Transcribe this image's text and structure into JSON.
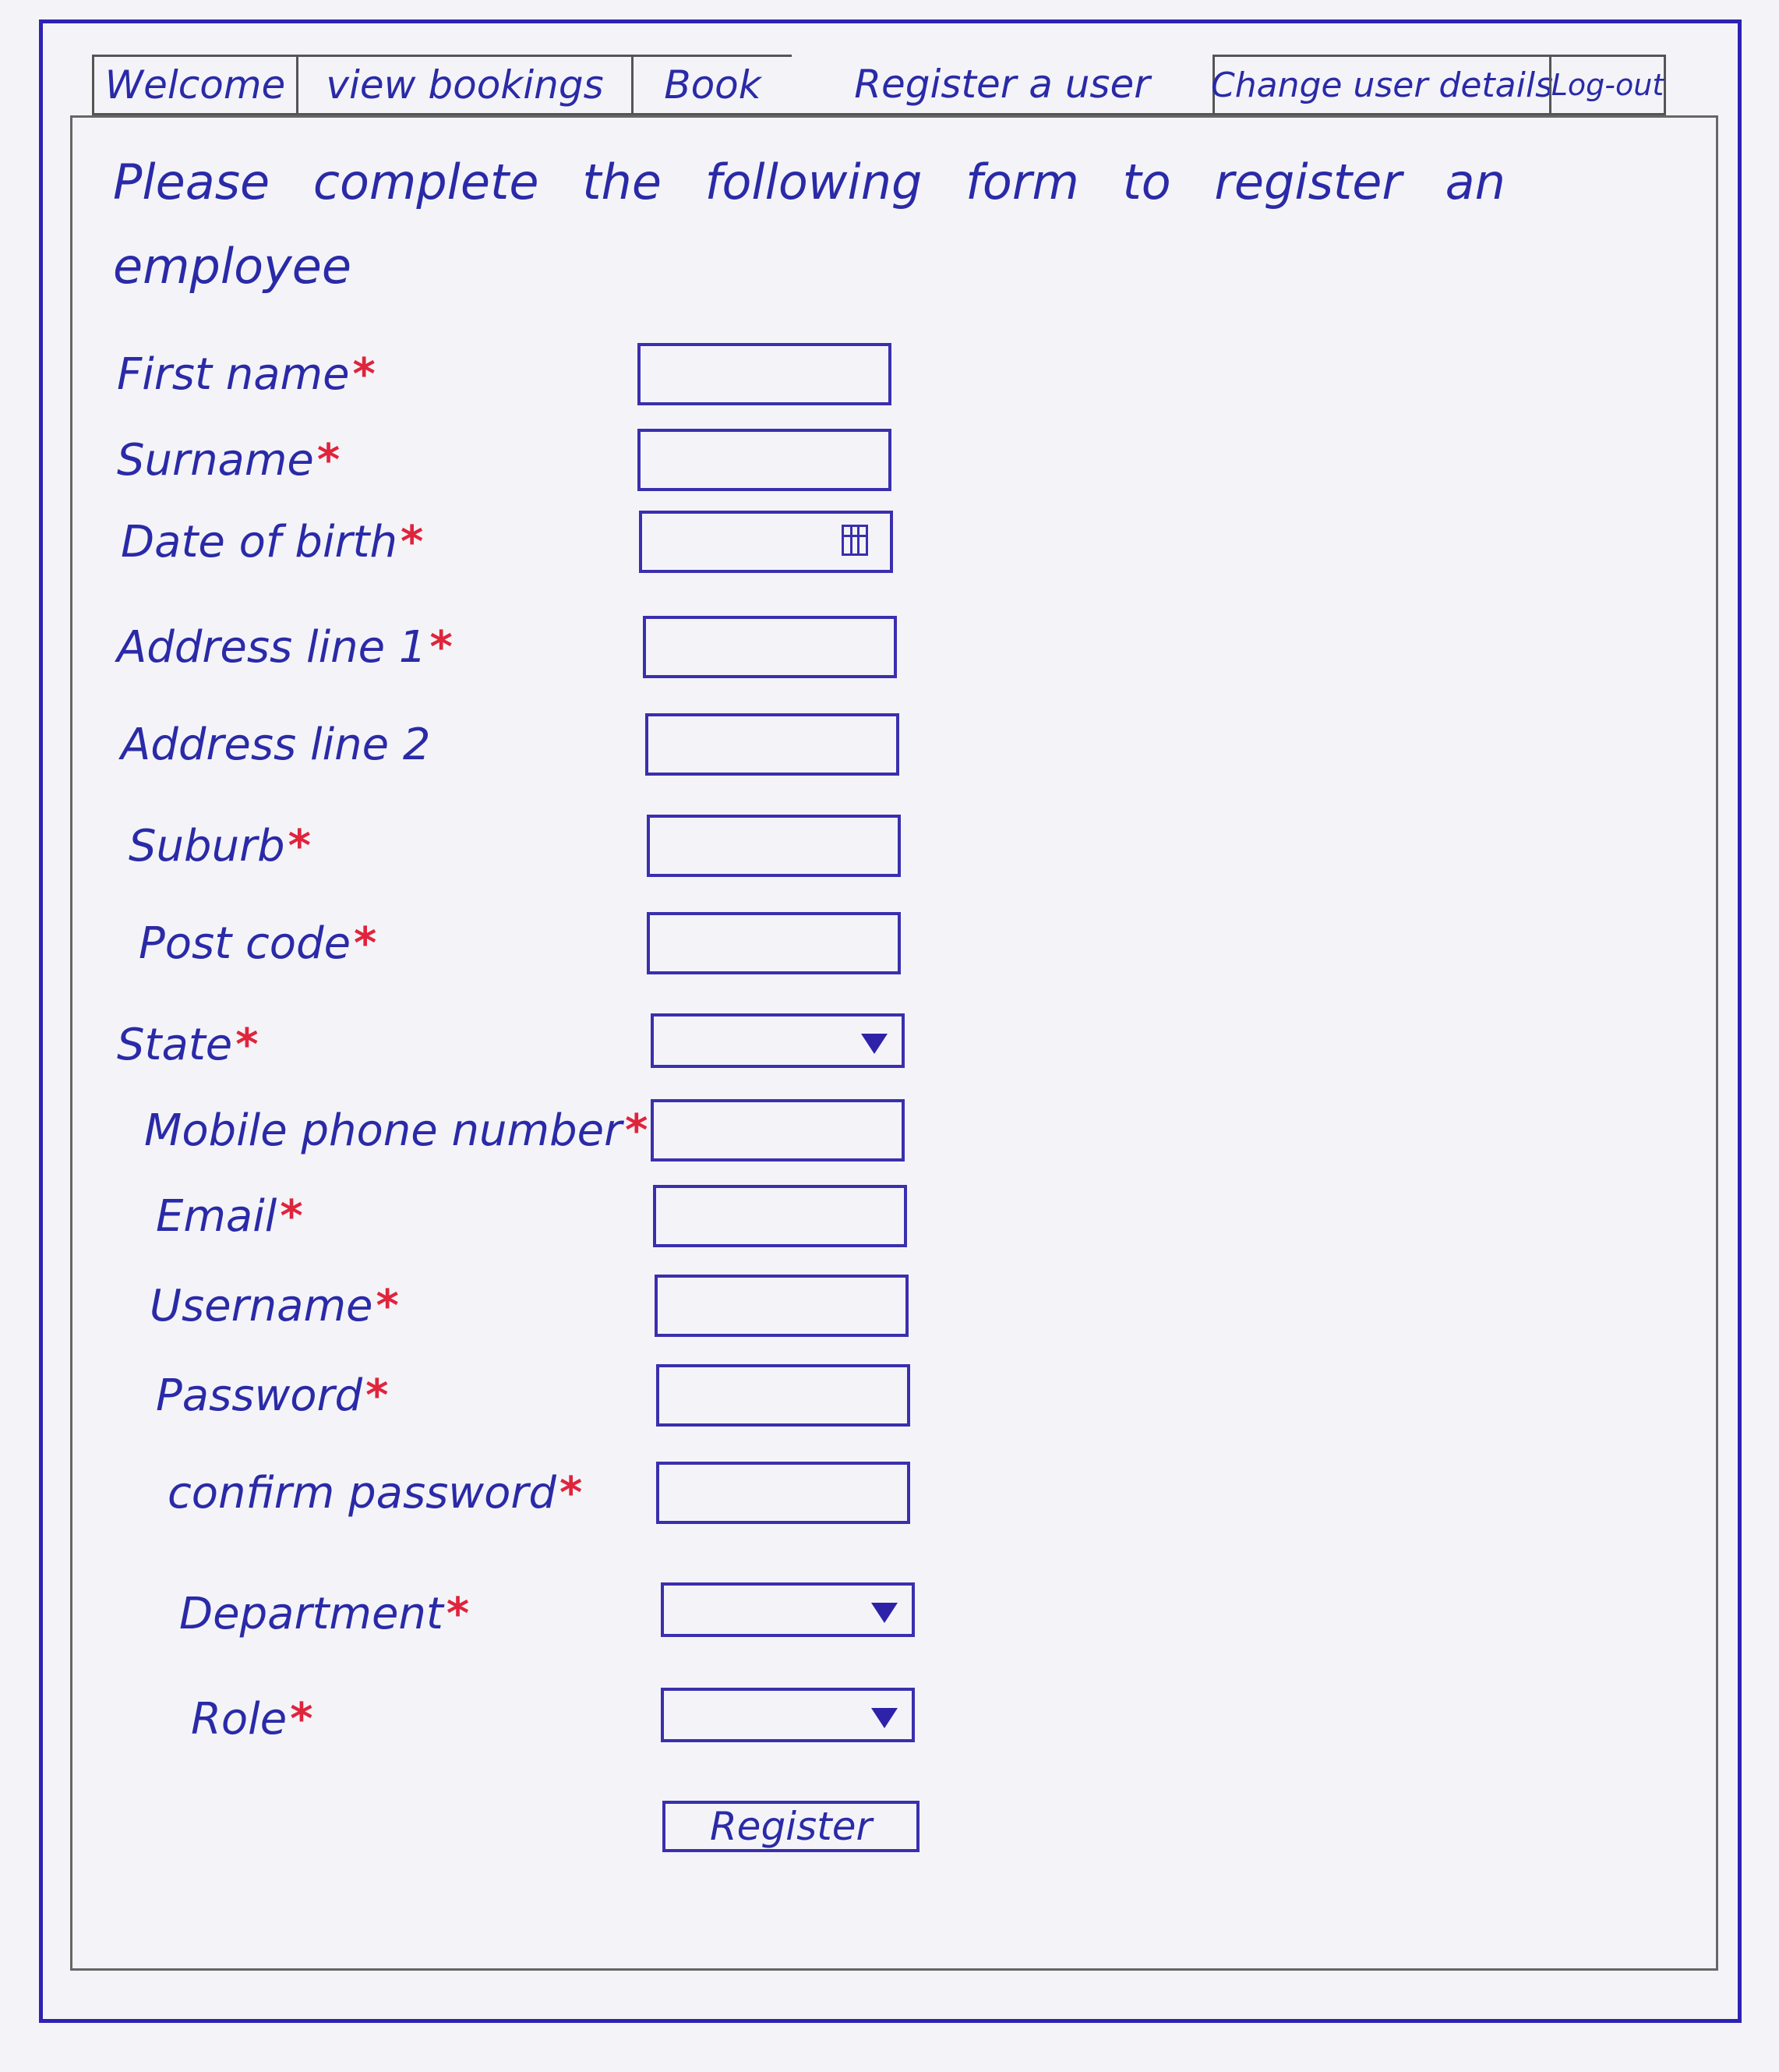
{
  "tabs": [
    {
      "label": "Welcome"
    },
    {
      "label": "view bookings"
    },
    {
      "label": "Book"
    },
    {
      "label": "Register a user"
    },
    {
      "label": "Change user details"
    },
    {
      "label": "Log-out"
    }
  ],
  "intro": "Please complete the following form to register an employee",
  "required_marker": "*",
  "fields": [
    {
      "label": "First name",
      "required": true,
      "type": "text"
    },
    {
      "label": "Surname",
      "required": true,
      "type": "text"
    },
    {
      "label": "Date of birth",
      "required": true,
      "type": "date"
    },
    {
      "label": "Address line 1",
      "required": true,
      "type": "text"
    },
    {
      "label": "Address line 2",
      "required": false,
      "type": "text"
    },
    {
      "label": "Suburb",
      "required": true,
      "type": "text"
    },
    {
      "label": "Post code",
      "required": true,
      "type": "text"
    },
    {
      "label": "State",
      "required": true,
      "type": "select"
    },
    {
      "label": "Mobile phone number",
      "required": true,
      "type": "text"
    },
    {
      "label": "Email",
      "required": true,
      "type": "text"
    },
    {
      "label": "Username",
      "required": true,
      "type": "text"
    },
    {
      "label": "Password",
      "required": true,
      "type": "password"
    },
    {
      "label": "confirm password",
      "required": true,
      "type": "password"
    },
    {
      "label": "Department",
      "required": true,
      "type": "select"
    },
    {
      "label": "Role",
      "required": true,
      "type": "select"
    }
  ],
  "register_label": "Register",
  "colors": {
    "ink": "#2a2aa8",
    "required": "#e0243c",
    "frame": "#2e22b4",
    "paper": "#f4f4f8"
  }
}
